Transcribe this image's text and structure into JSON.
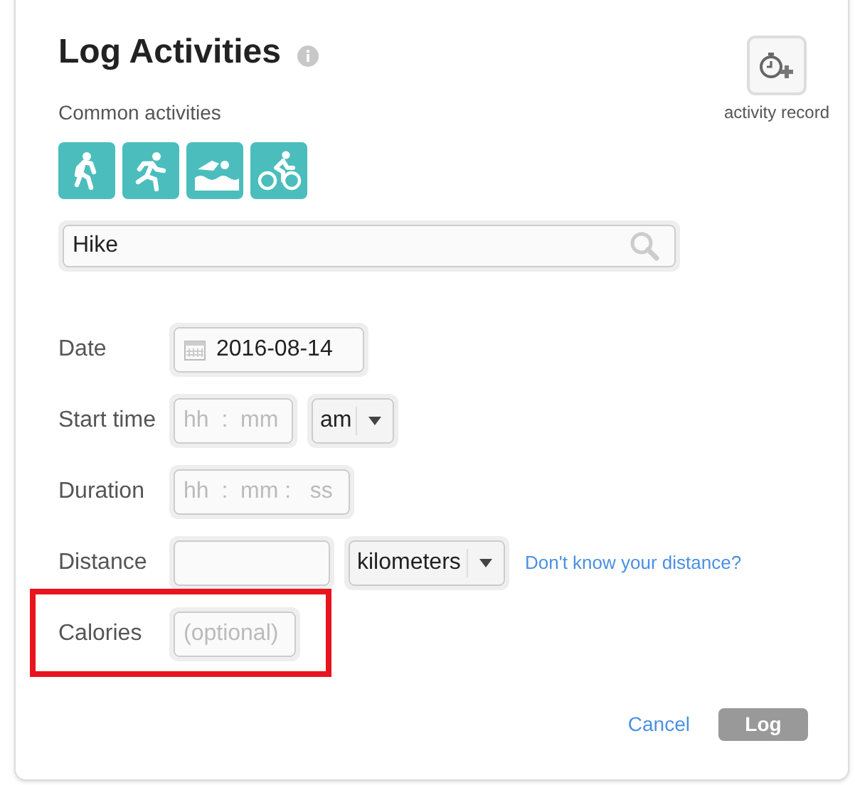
{
  "title": "Log Activities",
  "record": {
    "label": "activity record"
  },
  "common": {
    "label": "Common activities",
    "activities": [
      {
        "kind": "walk"
      },
      {
        "kind": "run"
      },
      {
        "kind": "swim"
      },
      {
        "kind": "bike"
      }
    ]
  },
  "search": {
    "value": "Hike"
  },
  "rows": [
    {
      "kind": "date",
      "label": "Date",
      "value": "2016-08-14",
      "highlighted": false
    },
    {
      "kind": "time",
      "label": "Start time",
      "placeholder": "hh  :  mm",
      "select": "am",
      "highlighted": false
    },
    {
      "kind": "duration",
      "label": "Duration",
      "placeholder": "hh  :  mm :   ss",
      "highlighted": false
    },
    {
      "kind": "distance",
      "label": "Distance",
      "select": "kilometers",
      "link": "Don't know your distance?",
      "highlighted": false
    },
    {
      "kind": "calories",
      "label": "Calories",
      "placeholder": "(optional)",
      "highlighted": true
    }
  ],
  "actions": {
    "cancel": "Cancel",
    "submit": "Log"
  }
}
